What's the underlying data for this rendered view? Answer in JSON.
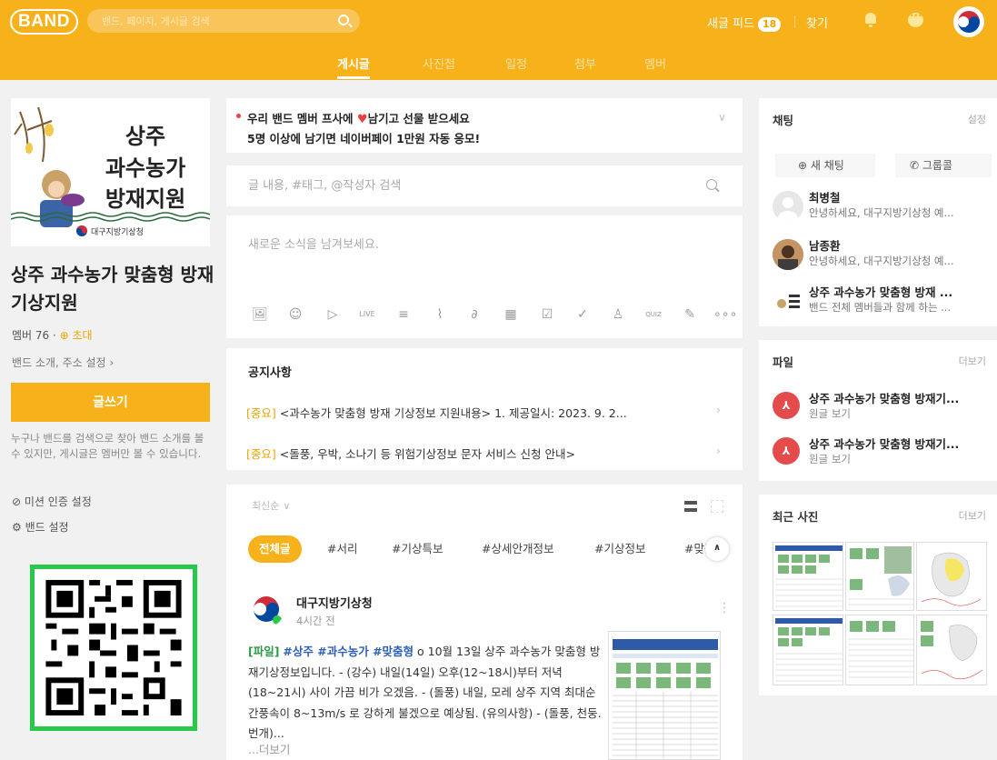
{
  "topbar": {
    "logo": "BAND",
    "search_placeholder": "밴드, 페이지, 게시글 검색",
    "new_feed_label": "새글 피드",
    "new_feed_count": "18",
    "find_label": "찾기"
  },
  "tabs": [
    "게시글",
    "사진첩",
    "일정",
    "첨부",
    "멤버"
  ],
  "sidebar": {
    "cover_line1": "상주",
    "cover_line2": "과수농가",
    "cover_line3": "방재지원",
    "cover_org": "대구지방기상청",
    "band_name": "상주 과수농가 맞춤형 방재 기상지원",
    "member_label": "멤버 76",
    "invite_label": "초대",
    "intro_link": "밴드 소개, 주소 설정",
    "write_button": "글쓰기",
    "description": "누구나 밴드를 검색으로 찾아 밴드 소개를 볼 수 있지만, 게시글은 멤버만 볼 수 있습니다.",
    "mission_label": "미션 인증 설정",
    "settings_label": "밴드 설정"
  },
  "banner": {
    "line1_a": "우리 밴드 멤버 프사에",
    "line1_b": "남기고 선물 받으세요",
    "line2": "5명 이상에 남기면 네이버페이 1만원 자동 응모!"
  },
  "post_search_placeholder": "글 내용, #태그, @작성자 검색",
  "compose_placeholder": "새로운 소식을 남겨보세요.",
  "notice": {
    "title": "공지사항",
    "items": [
      {
        "tag": "[중요]",
        "text": "<과수농가 맞춤형 방재 기상정보 지원내용> 1. 제공일시: 2023. 9. 2..."
      },
      {
        "tag": "[중요]",
        "text": "<돌풍, 우박, 소나기 등 위험기상정보 문자 서비스 신청 안내>"
      }
    ]
  },
  "feed": {
    "sort_label": "최신순",
    "chips": [
      "전체글",
      "#서리",
      "#기상특보",
      "#상세안개정보",
      "#기상정보",
      "#맞춤"
    ],
    "post": {
      "author": "대구지방기상청",
      "time": "4시간 전",
      "tag_file": "[파일]",
      "tags": "#상주 #과수농가 #맞춤형",
      "body": "o 10월 13일 상주 과수농가 맞춤형 방재기상정보입니다. - (강수) 내일(14일) 오후(12~18시)부터 저녁(18~21시) 사이 가끔 비가 오겠음. - (돌풍) 내일, 모레 상주 지역 최대순간풍속이 8~13m/s 로 강하게 불겠으로 예상됨. (유의사항) - (돌풍, 천둥.번개)...",
      "more": "...더보기"
    }
  },
  "chat": {
    "title": "채팅",
    "settings": "설정",
    "new_chat": "새 채팅",
    "group_call": "그룹콜",
    "items": [
      {
        "name": "최병철",
        "msg": "안녕하세요, 대구지방기상청 예..."
      },
      {
        "name": "남종환",
        "msg": "안녕하세요, 대구지방기상청 예..."
      },
      {
        "name": "상주 과수농가 맞춤형 방재 ...",
        "msg": "밴드 전체 멤버들과 함께 하는 ..."
      }
    ]
  },
  "files": {
    "title": "파일",
    "more": "더보기",
    "items": [
      {
        "name": "상주 과수농가 맞춤형 방재기...",
        "sub": "원글 보기"
      },
      {
        "name": "상주 과수농가 맞춤형 방재기...",
        "sub": "원글 보기"
      }
    ]
  },
  "photos": {
    "title": "최근 사진",
    "more": "더보기"
  },
  "colors": {
    "brand": "#f7b21b",
    "qr_border": "#2ac84a",
    "pdf": "#e44b4b"
  }
}
